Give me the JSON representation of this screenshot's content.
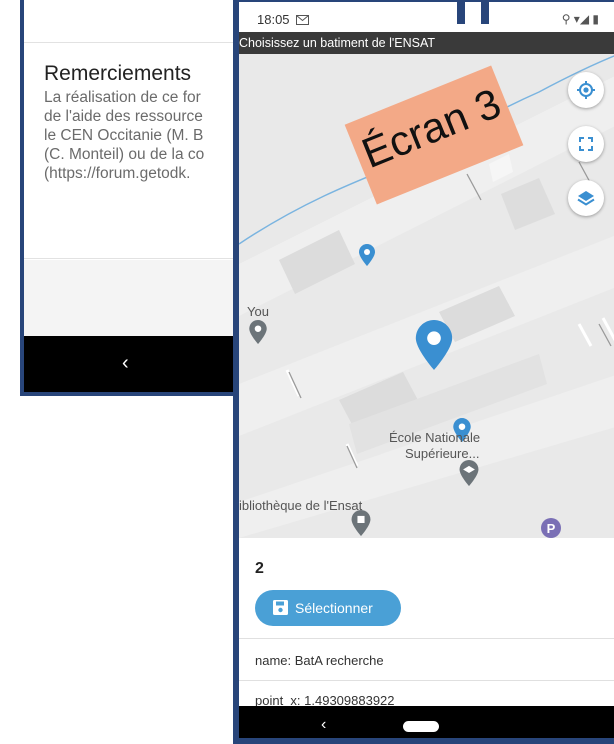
{
  "back_screen": {
    "title": "Remerciements",
    "text_lines": [
      "La réalisation de ce for",
      "de l'aide des ressource",
      "le CEN Occitanie (M. B",
      "(C. Monteil) ou de la co",
      "(https://forum.getodk."
    ],
    "nav_back": "‹"
  },
  "status_bar": {
    "time": "18:05",
    "notification_icon": "gmail-icon",
    "icons": "⚲ ▾◢ ▮"
  },
  "app_header": {
    "title": "Choisissez un batiment de l'ENSAT"
  },
  "map": {
    "badge": "Écran 3",
    "labels": {
      "you": "You",
      "school_line1": "École Nationale",
      "school_line2": "Supérieure...",
      "library": "ibliothèque de l'Ensat"
    },
    "controls": [
      "locate-icon",
      "fullscreen-icon",
      "layers-icon"
    ],
    "colors": {
      "pin": "#3a8fd1",
      "grey_pin": "#6c7479",
      "road_blue": "#7ab4e0",
      "badge": "#f3a987"
    }
  },
  "details": {
    "count": "2",
    "select_label": "Sélectionner",
    "name_row": "name: BatA recherche",
    "point_row": "point_x: 1.49309883922"
  },
  "nav": {
    "back": "‹"
  },
  "colors": {
    "frame": "#28457a",
    "accent": "#4aa0d6",
    "header": "#3a3a3a"
  }
}
